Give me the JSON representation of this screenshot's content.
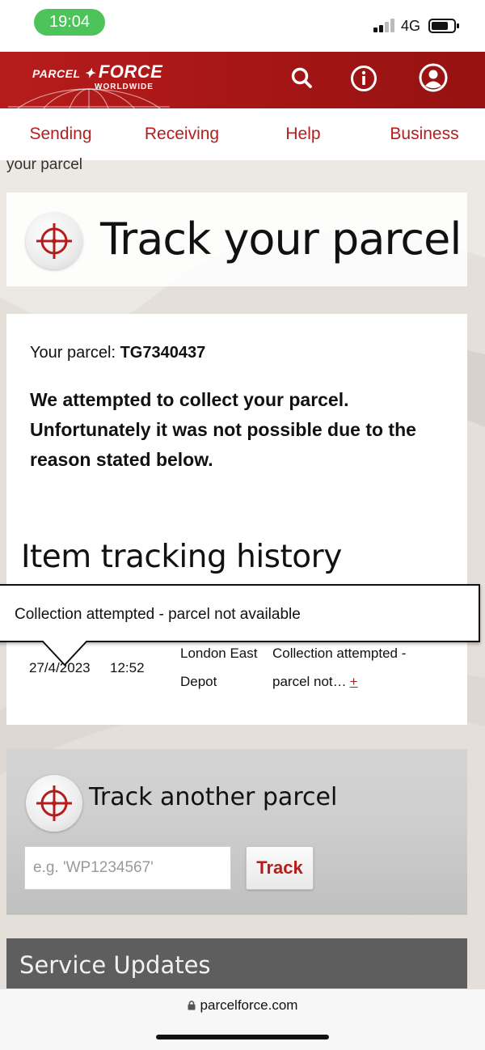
{
  "status_bar": {
    "time": "19:04",
    "network": "4G"
  },
  "header": {
    "logo_part1": "PARCEL",
    "logo_part2": "FORCE",
    "logo_sub": "WORLDWIDE",
    "brand_color": "#a31515"
  },
  "nav": {
    "items": [
      {
        "label": "Sending"
      },
      {
        "label": "Receiving"
      },
      {
        "label": "Help"
      },
      {
        "label": "Business"
      }
    ]
  },
  "breadcrumb": "your parcel",
  "track": {
    "title": "Track your parcel"
  },
  "parcel": {
    "label": "Your parcel:",
    "number": "TG7340437",
    "message": "We attempted to collect your parcel. Unfortunately it was not possible due to the reason stated below."
  },
  "history": {
    "title": "Item tracking history",
    "rows": [
      {
        "date": "27/4/2023",
        "time": "12:52",
        "location_line1": "London East",
        "location_line2": "Depot",
        "status_line1": "Collection attempted -",
        "status_line2": "parcel not…",
        "expand": "+"
      }
    ]
  },
  "tooltip": {
    "text": "Collection attempted - parcel not available"
  },
  "track_another": {
    "title": "Track another parcel",
    "placeholder": "e.g. 'WP1234567'",
    "button": "Track"
  },
  "service_updates": {
    "title": "Service Updates"
  },
  "browser": {
    "url": "parcelforce.com"
  }
}
